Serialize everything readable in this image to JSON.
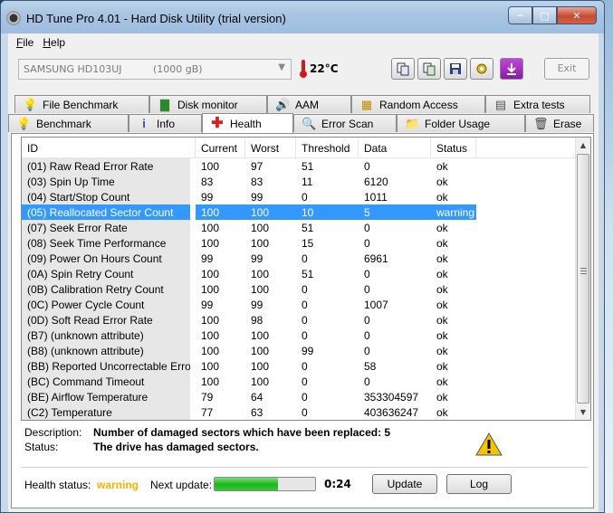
{
  "window": {
    "title": "HD Tune Pro 4.01 - Hard Disk Utility (trial version)",
    "controls": {
      "minimize": "─",
      "maximize": "□",
      "close": "✕"
    }
  },
  "menu": {
    "file": "File",
    "file_key": "F",
    "file_rest": "ile",
    "help_key": "H",
    "help_rest": "elp"
  },
  "toolbar": {
    "drive_name": "SAMSUNG HD103UJ",
    "drive_capacity": "(1000 gB)",
    "temperature": "22°C",
    "exit_label": "Exit",
    "icons": [
      "copy-icon",
      "copy-all-icon",
      "save-icon",
      "options-icon",
      "download-icon"
    ]
  },
  "tabs": {
    "row1": [
      "File Benchmark",
      "Disk monitor",
      "AAM",
      "Random Access",
      "Extra tests"
    ],
    "row2": [
      "Benchmark",
      "Info",
      "Health",
      "Error Scan",
      "Folder Usage",
      "Erase"
    ],
    "active": "Health"
  },
  "table": {
    "headers": [
      "ID",
      "Current",
      "Worst",
      "Threshold",
      "Data",
      "Status"
    ],
    "selected_index": 3,
    "rows": [
      [
        "(01) Raw Read Error Rate",
        "100",
        "97",
        "51",
        "0",
        "ok"
      ],
      [
        "(03) Spin Up Time",
        "83",
        "83",
        "11",
        "6120",
        "ok"
      ],
      [
        "(04) Start/Stop Count",
        "99",
        "99",
        "0",
        "1011",
        "ok"
      ],
      [
        "(05) Reallocated Sector Count",
        "100",
        "100",
        "10",
        "5",
        "warning"
      ],
      [
        "(07) Seek Error Rate",
        "100",
        "100",
        "51",
        "0",
        "ok"
      ],
      [
        "(08) Seek Time Performance",
        "100",
        "100",
        "15",
        "0",
        "ok"
      ],
      [
        "(09) Power On Hours Count",
        "99",
        "99",
        "0",
        "6961",
        "ok"
      ],
      [
        "(0A) Spin Retry Count",
        "100",
        "100",
        "51",
        "0",
        "ok"
      ],
      [
        "(0B) Calibration Retry Count",
        "100",
        "100",
        "0",
        "0",
        "ok"
      ],
      [
        "(0C) Power Cycle Count",
        "99",
        "99",
        "0",
        "1007",
        "ok"
      ],
      [
        "(0D) Soft Read Error Rate",
        "100",
        "98",
        "0",
        "0",
        "ok"
      ],
      [
        "(B7) (unknown attribute)",
        "100",
        "100",
        "0",
        "0",
        "ok"
      ],
      [
        "(B8) (unknown attribute)",
        "100",
        "100",
        "99",
        "0",
        "ok"
      ],
      [
        "(BB) Reported Uncorrectable Errors",
        "100",
        "100",
        "0",
        "58",
        "ok"
      ],
      [
        "(BC) Command Timeout",
        "100",
        "100",
        "0",
        "0",
        "ok"
      ],
      [
        "(BE) Airflow Temperature",
        "79",
        "64",
        "0",
        "353304597",
        "ok"
      ],
      [
        "(C2) Temperature",
        "77",
        "63",
        "0",
        "403636247",
        "ok"
      ]
    ]
  },
  "details": {
    "description_label": "Description:",
    "description": "Number of damaged sectors which have been replaced: 5",
    "status_label": "Status:",
    "status": "The drive has damaged sectors."
  },
  "footer": {
    "health_status_label": "Health status:",
    "health_status": "warning",
    "next_update_label": "Next update:",
    "next_update": "0:24",
    "progress_fraction": 0.63,
    "update_label": "Update",
    "log_label": "Log"
  },
  "colors": {
    "selection": "#3399ff",
    "warning_text": "#f0b400",
    "progress": "#1fb51f"
  }
}
